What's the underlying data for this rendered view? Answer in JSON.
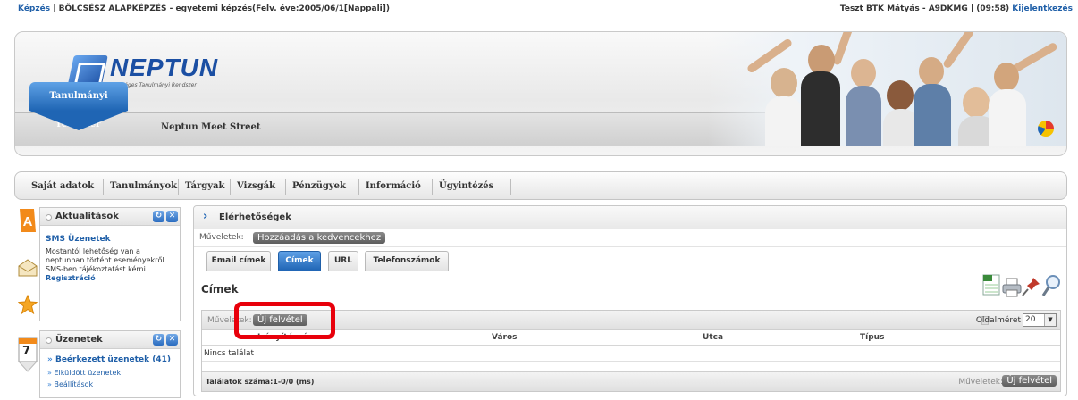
{
  "topbar": {
    "training_link": "Képzés",
    "training_info": " | BÖLCSÉSZ ALAPKÉPZÉS - egyetemi képzés(Felv. éve:2005/06/1[Nappali])",
    "user": "Teszt BTK Mátyás - A9DKMG",
    "session": " | (09:58) ",
    "logout": "Kijelentkezés"
  },
  "header": {
    "logo_word": "NEPTUN",
    "logo_sub": "Egységes Tanulmányi Rendszer",
    "tab_active": "Tanulmányi rendszer",
    "tab_other": "Neptun Meet Street"
  },
  "mainmenu": [
    "Saját adatok",
    "Tanulmányok",
    "Tárgyak",
    "Vizsgák",
    "Pénzügyek",
    "Információ",
    "Ügyintézés"
  ],
  "news_panel": {
    "title": "Aktualitások",
    "item_title": "SMS Üzenetek",
    "item_lines": [
      "Mostantól lehetőség van a",
      "neptunban történt eseményekről",
      "SMS-ben tájékoztatást kérni."
    ],
    "item_link": "Regisztráció"
  },
  "messages_panel": {
    "title": "Üzenetek",
    "calendar_day": "7",
    "items": [
      "Beérkezett üzenetek (41)",
      "Elküldött üzenetek",
      "Beállítások"
    ]
  },
  "content": {
    "title": "Elérhetőségek",
    "ops_label": "Műveletek:",
    "fav_button": "Hozzáadás a kedvencekhez",
    "tabs": [
      "Email címek",
      "Címek",
      "URL",
      "Telefonszámok"
    ],
    "active_tab": "Címek",
    "section_title": "Címek",
    "grid": {
      "ops_label": "Műveletek:",
      "new_button": "Új felvétel",
      "page_size_label": "Oldalméret",
      "page_size": "20",
      "columns": [
        "Irányítószám",
        "Város",
        "Utca",
        "Típus"
      ],
      "empty_text": "Nincs találat",
      "results": "Találatok száma:1-0/0 (ms)",
      "footer_ops_label": "Műveletek:",
      "footer_new_button": "Új felvétel"
    }
  },
  "colors": {
    "accent_blue": "#1f65b4",
    "link_blue": "#1f5fa8",
    "highlight_red": "#e8000b"
  }
}
